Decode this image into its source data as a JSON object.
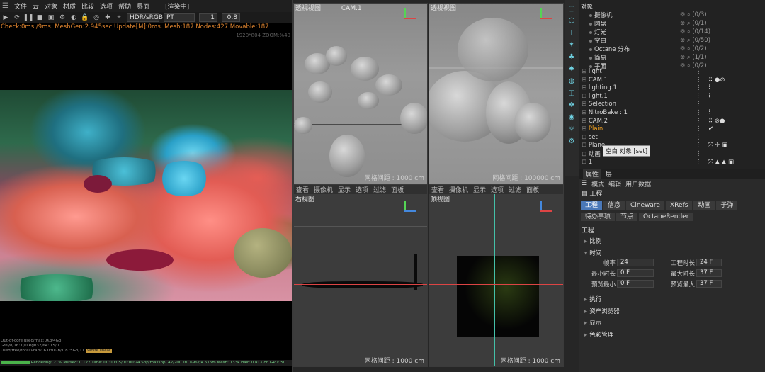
{
  "left_viewer": {
    "menu": [
      "文件",
      "云",
      "对象",
      "材质",
      "比较",
      "选项",
      "帮助",
      "界面",
      "[渲染中]"
    ],
    "toolbar": {
      "color_space": "HDR/sRGB",
      "mode": "PT",
      "value1": "1",
      "value2": "0.8"
    },
    "status": "Check:0ms./9ms. MeshGen:2.945sec Update[M]:0ms. Mesh:187 Nodes:427 Movable:187",
    "resolution": "1920*804 ZOOM:%40",
    "bottom_lines": [
      "Out-of-core used/max:0Kb/4Gb",
      "Grey8/16: 0/0      Rgb32/64: 15/0",
      "Used/free/total vram: 6.030Gb/1.875Gb/11",
      "Rendering: 21%   Ms/sec: 0.127   Time: 00:00:05/00:00:24   Spp/maxspp: 42/200   Tri: 696k/4.616m   Mesh: 133k   Hair: 0   RTX:on   GPU: 50"
    ],
    "warning": "White linear"
  },
  "viewports": [
    {
      "title": "透视视图",
      "camera": "CAM.1",
      "grid": "网格间距 : 1000 cm"
    },
    {
      "title": "透视视图",
      "camera": "",
      "grid": "网格间距 : 100000 cm"
    },
    {
      "title": "右视图",
      "camera": "",
      "grid": "网格间距 : 1000 cm",
      "menu": [
        "查看",
        "摄像机",
        "显示",
        "选项",
        "过滤",
        "面板"
      ]
    },
    {
      "title": "顶视图",
      "camera": "",
      "grid": "网格间距 : 1000 cm",
      "menu": [
        "查看",
        "摄像机",
        "显示",
        "选项",
        "过滤",
        "面板"
      ]
    }
  ],
  "object_manager": {
    "root": "对象",
    "stats": [
      {
        "name": "摄像机",
        "value": "(0/3)"
      },
      {
        "name": "圆盘",
        "value": "(0/1)"
      },
      {
        "name": "灯光",
        "value": "(0/14)"
      },
      {
        "name": "空白",
        "value": "(0/50)"
      },
      {
        "name": "Octane 分布",
        "value": "(0/2)"
      },
      {
        "name": "简易",
        "value": "(1/1)"
      },
      {
        "name": "平面",
        "value": "(0/2)"
      }
    ],
    "objects": [
      "light",
      "CAM.1",
      "lighting.1",
      "light.1",
      "Selection",
      "NitroBake : 1",
      "CAM.2",
      "Plain",
      "set",
      "Plane",
      "动画",
      "1"
    ],
    "tooltip": "空白 对象 [set]"
  },
  "attributes": {
    "tabs": [
      "属性",
      "层"
    ],
    "menu": [
      "模式",
      "编辑",
      "用户数据"
    ],
    "mode": "工程",
    "chips_row1": [
      "工程",
      "信息",
      "Cineware",
      "XRefs",
      "动画",
      "子弹"
    ],
    "chips_row2": [
      "待办事项",
      "节点",
      "OctaneRender"
    ],
    "heading": "工程",
    "sections": [
      "比例",
      "时间",
      "执行",
      "资产浏览器",
      "显示",
      "色彩管理"
    ],
    "fields": [
      {
        "label": "帧率",
        "value": "24",
        "label2": "工程时长",
        "value2": "24 F"
      },
      {
        "label": "最小时长",
        "value": "0 F",
        "label2": "最大时长",
        "value2": "37 F"
      },
      {
        "label": "预览最小",
        "value": "0 F",
        "label2": "预览最大",
        "value2": "37 F"
      }
    ]
  },
  "colors": {
    "accent": "#4a78b8",
    "status_orange": "#e0852f",
    "axis_green": "#55d455",
    "axis_red": "#dd4444"
  }
}
